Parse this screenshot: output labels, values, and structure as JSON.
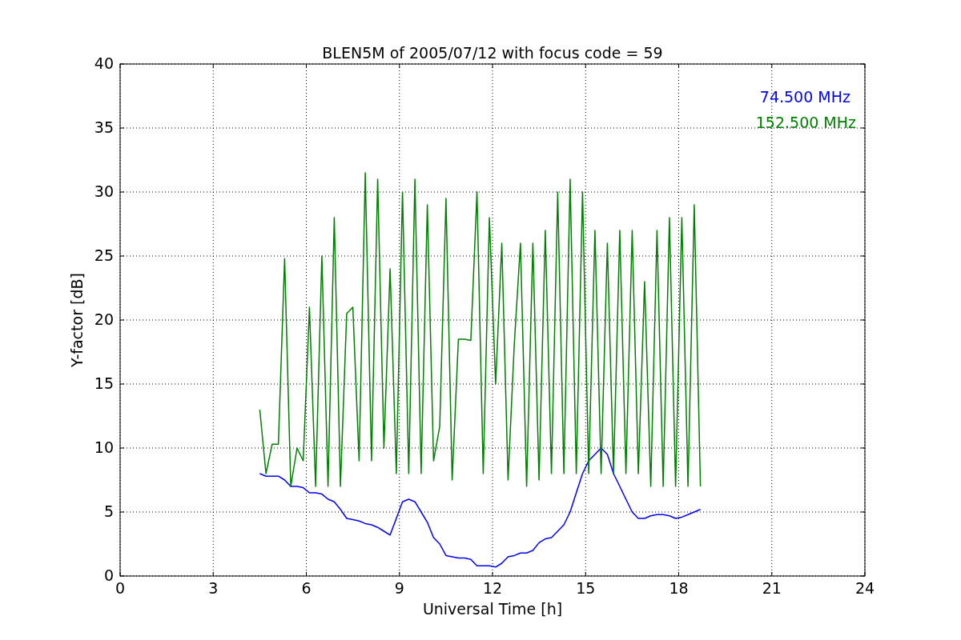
{
  "figure": {
    "chart_data": {
      "type": "line",
      "grid": true,
      "title": "BLEN5M of 2005/07/12 with focus code = 59",
      "xlabel": "Universal Time [h]",
      "ylabel": "Y-factor [dB]",
      "xlim": [
        0,
        24
      ],
      "ylim": [
        0,
        40
      ],
      "xticks": [
        0,
        3,
        6,
        9,
        12,
        15,
        18,
        21,
        24
      ],
      "yticks": [
        0,
        5,
        10,
        15,
        20,
        25,
        30,
        35,
        40
      ],
      "x": [
        4.5,
        4.7,
        4.9,
        5.1,
        5.3,
        5.5,
        5.7,
        5.9,
        6.1,
        6.3,
        6.5,
        6.7,
        6.9,
        7.1,
        7.3,
        7.5,
        7.7,
        7.9,
        8.1,
        8.3,
        8.5,
        8.7,
        8.9,
        9.1,
        9.3,
        9.5,
        9.7,
        9.9,
        10.1,
        10.3,
        10.5,
        10.7,
        10.9,
        11.1,
        11.3,
        11.5,
        11.7,
        11.9,
        12.1,
        12.3,
        12.5,
        12.7,
        12.9,
        13.1,
        13.3,
        13.5,
        13.7,
        13.9,
        14.1,
        14.3,
        14.5,
        14.7,
        14.9,
        15.1,
        15.3,
        15.5,
        15.7,
        15.9,
        16.1,
        16.3,
        16.5,
        16.7,
        16.9,
        17.1,
        17.3,
        17.5,
        17.7,
        17.9,
        18.1,
        18.3,
        18.5,
        18.7
      ],
      "series": [
        {
          "name": "74.500 MHz",
          "color": "#0000ff",
          "values": [
            8,
            7.8,
            7.8,
            7.8,
            7.5,
            7,
            7,
            6.9,
            6.5,
            6.5,
            6.4,
            6,
            5.8,
            5.2,
            4.5,
            4.4,
            4.3,
            4.1,
            4,
            3.8,
            3.5,
            3.2,
            4.5,
            5.8,
            6,
            5.8,
            5,
            4.2,
            3,
            2.5,
            1.6,
            1.5,
            1.4,
            1.4,
            1.3,
            0.8,
            0.8,
            0.8,
            0.7,
            1,
            1.5,
            1.6,
            1.8,
            1.8,
            2,
            2.6,
            2.9,
            3,
            3.5,
            4,
            5,
            6.5,
            8,
            9,
            9.5,
            10,
            9.5,
            8,
            7,
            6,
            5,
            4.5,
            4.5,
            4.7,
            4.8,
            4.8,
            4.7,
            4.5,
            4.6,
            4.8,
            5,
            5.2
          ]
        },
        {
          "name": "152.500 MHz",
          "color": "#008000",
          "values": [
            13,
            8,
            10.3,
            10.3,
            24.8,
            7,
            10,
            9,
            21,
            7,
            25,
            7,
            28,
            7,
            20.5,
            21,
            9,
            31.5,
            9,
            31,
            10,
            24,
            8,
            30,
            8,
            31,
            8,
            29,
            9,
            11.7,
            29.5,
            7.5,
            18.5,
            18.5,
            18.4,
            30,
            8,
            28,
            15,
            26,
            7.5,
            18,
            26,
            7,
            26,
            7.5,
            27,
            8,
            30,
            8,
            31,
            8,
            30,
            8,
            27,
            8,
            26,
            8,
            27,
            8,
            27,
            8,
            23,
            7,
            27,
            7,
            28,
            7,
            28,
            7,
            29,
            7
          ]
        }
      ]
    }
  }
}
